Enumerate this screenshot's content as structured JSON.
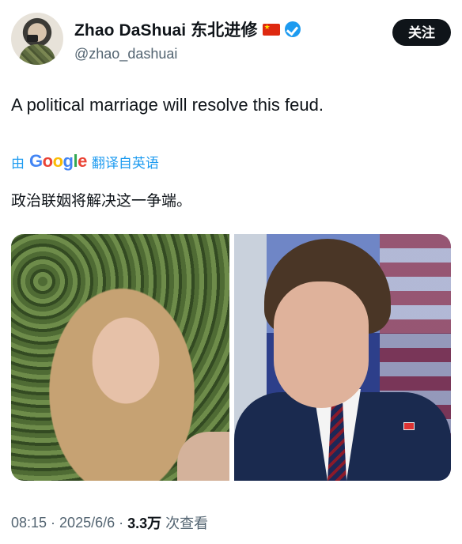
{
  "author": {
    "display_name": "Zhao DaShuai 东北进修",
    "handle": "@zhao_dashuai",
    "flag_icon": "china-flag-icon",
    "verified_icon": "verified-badge-icon"
  },
  "actions": {
    "follow_label": "关注"
  },
  "tweet": {
    "text": "A political marriage will resolve this feud.",
    "translation_prefix": "由",
    "translation_provider": "Google",
    "translation_suffix": "翻译自英语",
    "translated_text": "政治联姻将解决这一争端。"
  },
  "meta": {
    "time": "08:15",
    "separator": "·",
    "date": "2025/6/6",
    "view_count": "3.3万",
    "views_label": "次查看"
  },
  "colors": {
    "accent": "#1d9bf0",
    "text": "#0f1419",
    "muted": "#536471",
    "button_bg": "#0f1419"
  }
}
